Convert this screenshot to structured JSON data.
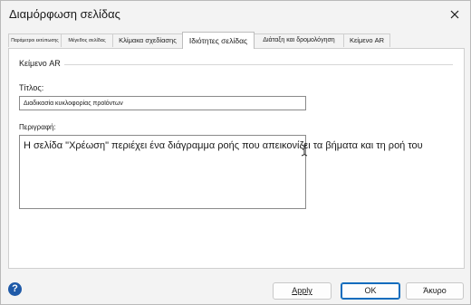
{
  "window": {
    "title": "Διαμόρφωση σελίδας"
  },
  "tabs": [
    {
      "label": "Παράμετροι εκτύπωσης"
    },
    {
      "label": "Μέγεθος σελίδας"
    },
    {
      "label": "Κλίμακα σχεδίασης"
    },
    {
      "label": "Ιδιότητες σελίδας"
    },
    {
      "label": "Διάταξη και δρομολόγηση"
    },
    {
      "label": "Κείμενο AR"
    }
  ],
  "active_tab_index": 3,
  "group": {
    "label": "Κείμενο AR"
  },
  "fields": {
    "title_label": "Τίτλος:",
    "title_value": "Διαδικασία κυκλοφορίας προϊόντων",
    "description_label": "Περιγραφή:",
    "description_value": "Η σελίδα \"Χρέωση\" περιέχει ένα διάγραμμα ροής που απεικονίζει τα βήματα και τη ροή του"
  },
  "buttons": {
    "apply": "Apply",
    "ok": "OK",
    "cancel": "Άκυρο"
  },
  "icons": {
    "close": "close-icon",
    "help": "help-icon",
    "cursor": "text-cursor-icon"
  },
  "colors": {
    "accent": "#0f6cbd",
    "help": "#1f5aa8"
  }
}
